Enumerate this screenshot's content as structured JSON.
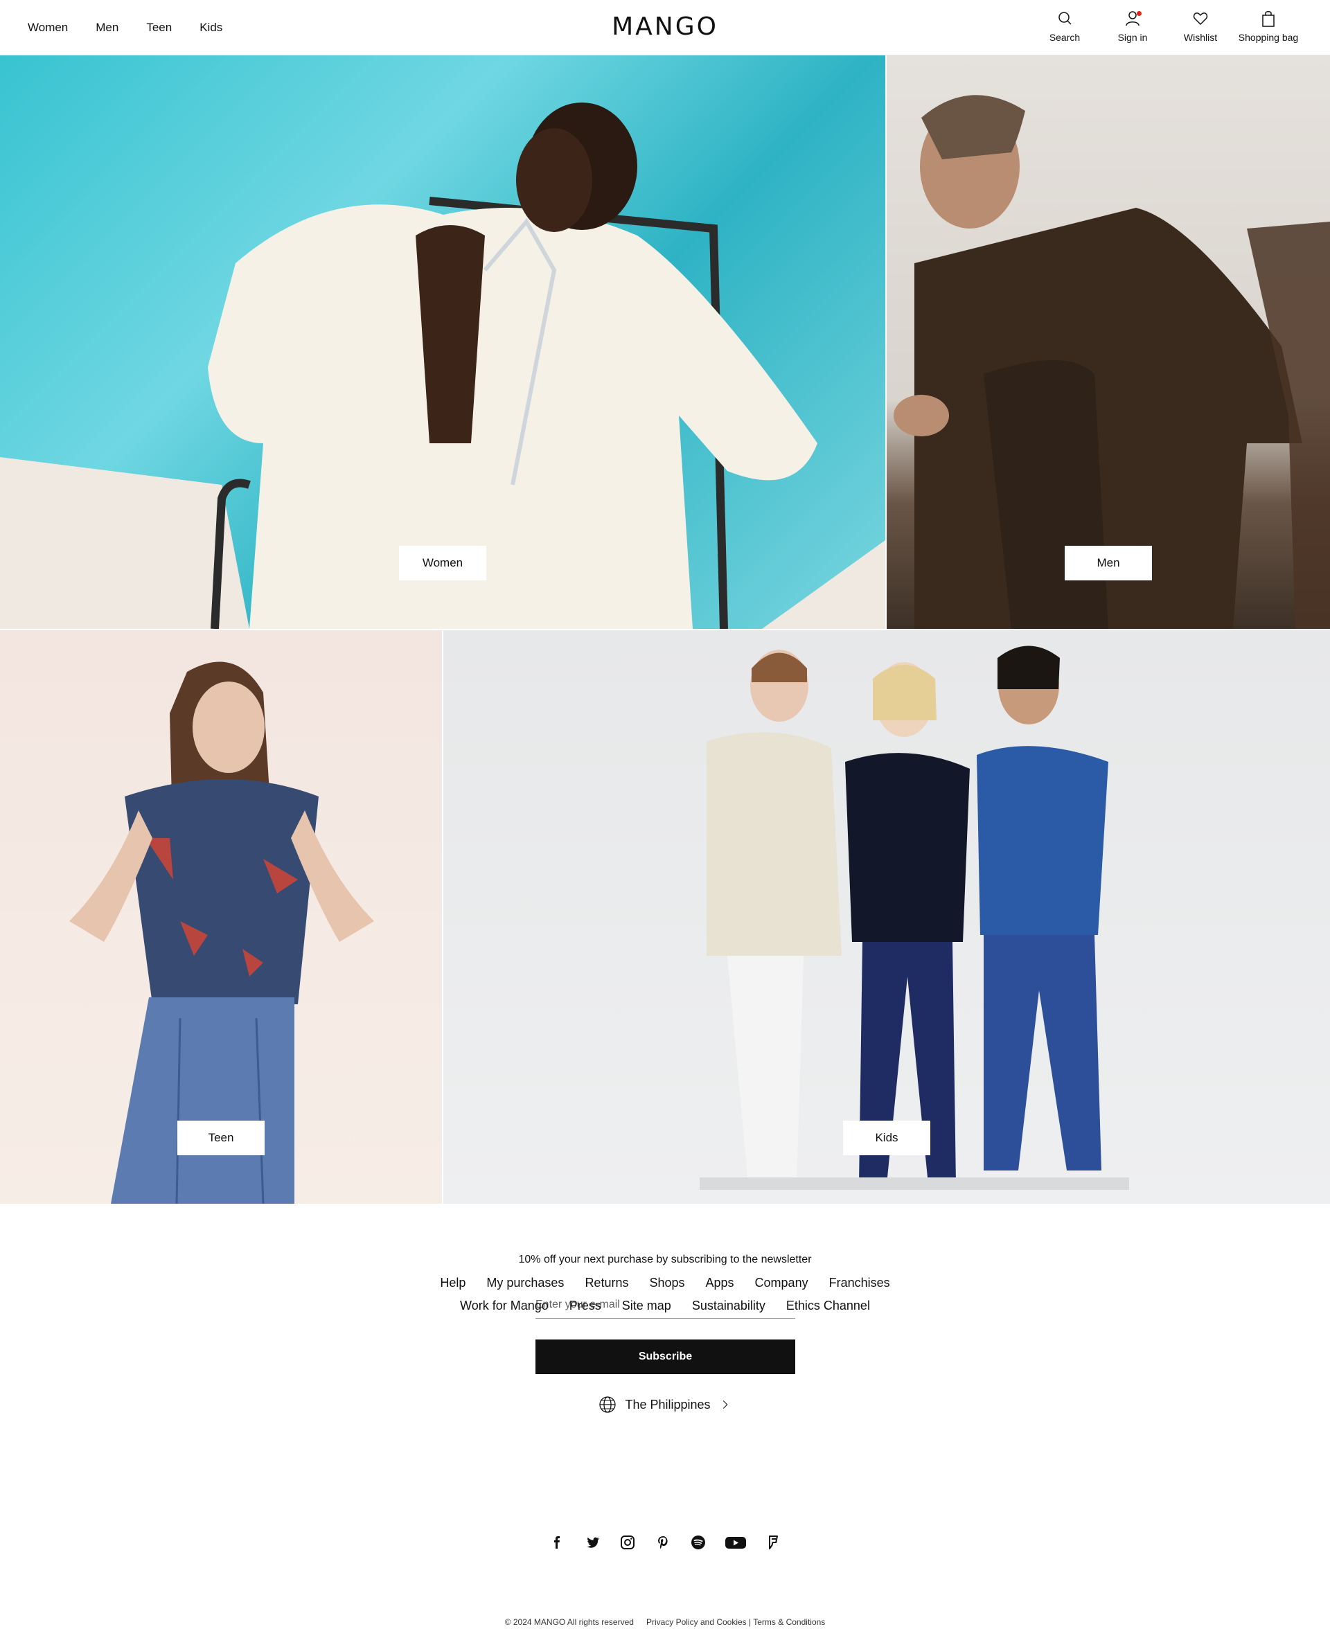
{
  "header": {
    "nav": [
      "Women",
      "Men",
      "Teen",
      "Kids"
    ],
    "logo": "MANGO",
    "actions": {
      "search": "Search",
      "sign_in": "Sign in",
      "wishlist": "Wishlist",
      "bag": "Shopping bag"
    }
  },
  "categories": {
    "women": "Women",
    "men": "Men",
    "teen": "Teen",
    "kids": "Kids"
  },
  "newsletter": {
    "title": "10% off your next purchase by subscribing to the newsletter",
    "placeholder": "Enter your e-mail",
    "button": "Subscribe"
  },
  "country": "The Philippines",
  "footer": {
    "row1": [
      "Help",
      "My purchases",
      "Returns",
      "Shops",
      "Apps",
      "Company",
      "Franchises"
    ],
    "row2": [
      "Work for Mango",
      "Press",
      "Site map",
      "Sustainability",
      "Ethics Channel"
    ]
  },
  "social_icons": [
    "facebook-icon",
    "twitter-icon",
    "instagram-icon",
    "pinterest-icon",
    "spotify-icon",
    "youtube-icon",
    "foursquare-icon"
  ],
  "legal": {
    "copyright": "© 2024 MANGO All rights reserved",
    "policy": "Privacy Policy and Cookies | Terms & Conditions"
  },
  "colors": {
    "text": "#111111",
    "button": "#111111",
    "notification": "#e1251b"
  }
}
